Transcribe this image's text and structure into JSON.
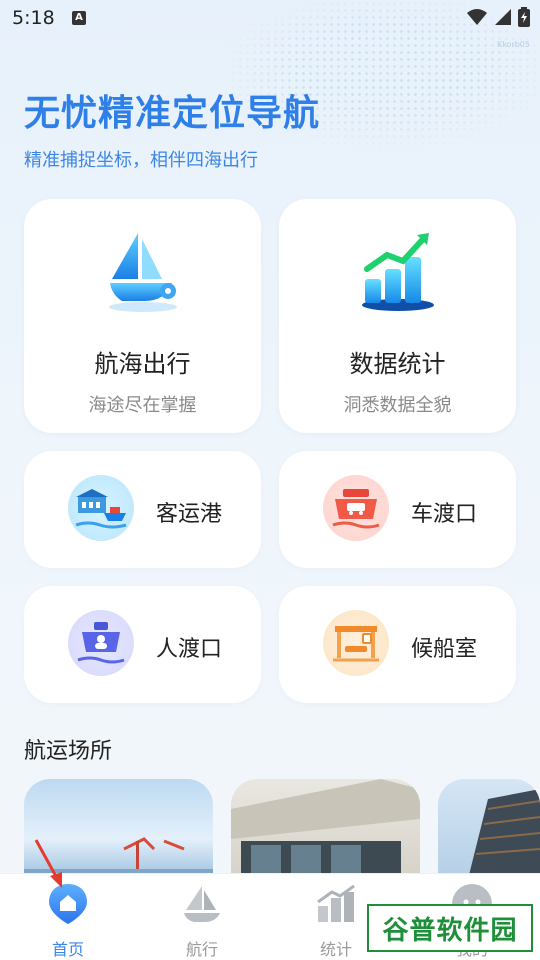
{
  "status": {
    "time": "5:18",
    "notif_icon": "A"
  },
  "watermark": "Kkorb05",
  "hero": {
    "title": "无忧精准定位导航",
    "subtitle": "精准捕捉坐标，相伴四海出行"
  },
  "cards_big": [
    {
      "title": "航海出行",
      "subtitle": "海途尽在掌握",
      "icon": "sailboat-icon"
    },
    {
      "title": "数据统计",
      "subtitle": "洞悉数据全貌",
      "icon": "bar-chart-icon"
    }
  ],
  "cards_small": [
    {
      "label": "客运港",
      "icon": "passenger-port-icon"
    },
    {
      "label": "车渡口",
      "icon": "car-ferry-icon"
    },
    {
      "label": "人渡口",
      "icon": "passenger-ferry-icon"
    },
    {
      "label": "候船室",
      "icon": "waiting-room-icon"
    }
  ],
  "section": {
    "title": "航运场所"
  },
  "tabs": [
    {
      "label": "首页",
      "icon": "home-location-icon",
      "active": true
    },
    {
      "label": "航行",
      "icon": "sail-icon",
      "active": false
    },
    {
      "label": "统计",
      "icon": "stats-icon",
      "active": false
    },
    {
      "label": "我的",
      "icon": "profile-icon",
      "active": false
    }
  ],
  "brand_badge": "谷普软件园",
  "colors": {
    "accent": "#2f7fe8",
    "tab_active": "#3a86ee",
    "tab_inactive": "#9a9a9a",
    "badge": "#1f8f3a"
  }
}
